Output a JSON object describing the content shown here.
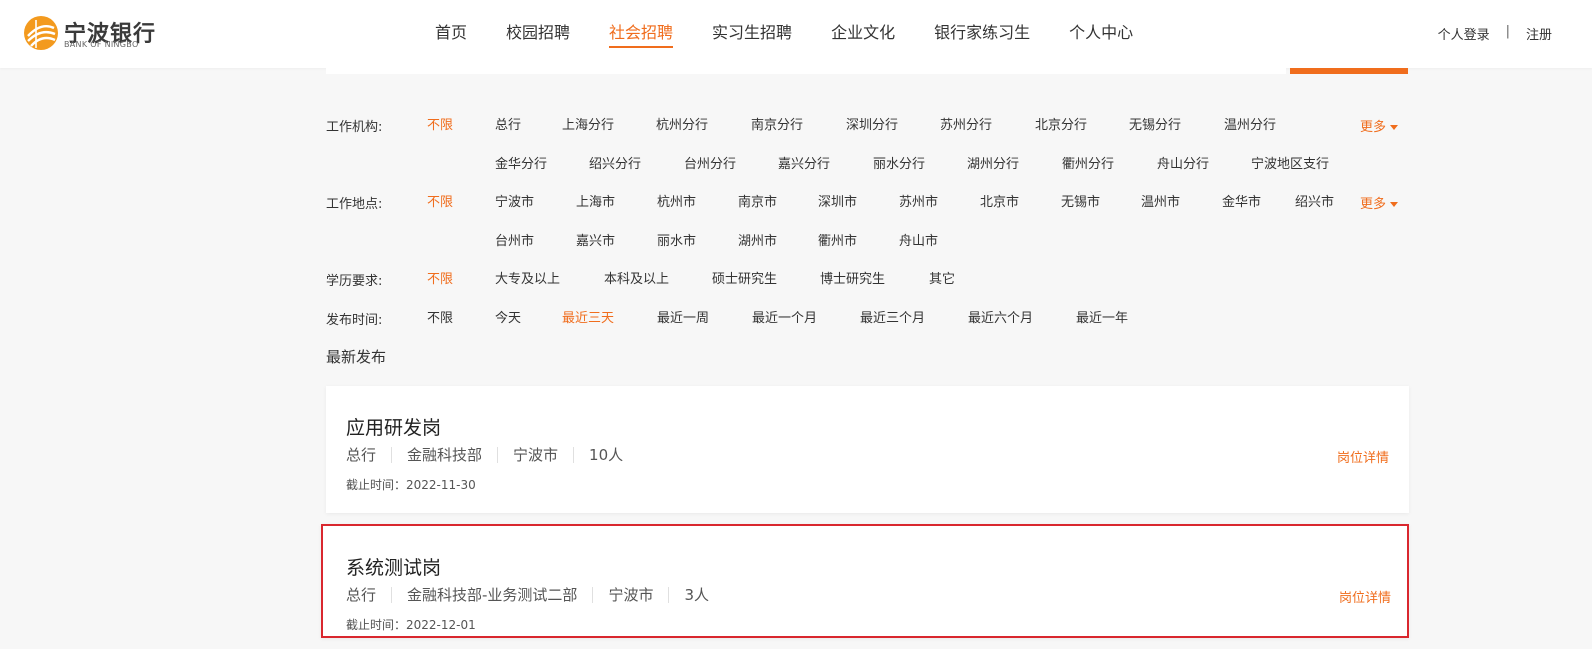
{
  "header": {
    "logo_cn": "宁波银行",
    "logo_en": "BANK OF NINGBO",
    "nav": [
      {
        "label": "首页",
        "active": false
      },
      {
        "label": "校园招聘",
        "active": false
      },
      {
        "label": "社会招聘",
        "active": true
      },
      {
        "label": "实习生招聘",
        "active": false
      },
      {
        "label": "企业文化",
        "active": false
      },
      {
        "label": "银行家练习生",
        "active": false
      },
      {
        "label": "个人中心",
        "active": false
      }
    ],
    "login": "个人登录",
    "separator": "|",
    "register": "注册"
  },
  "filters": {
    "org": {
      "label": "工作机构:",
      "unlimited": "不限",
      "row1": [
        "总行",
        "上海分行",
        "杭州分行",
        "南京分行",
        "深圳分行",
        "苏州分行",
        "北京分行",
        "无锡分行",
        "温州分行"
      ],
      "row2": [
        "金华分行",
        "绍兴分行",
        "台州分行",
        "嘉兴分行",
        "丽水分行",
        "湖州分行",
        "衢州分行",
        "舟山分行",
        "宁波地区支行"
      ],
      "more": "更多"
    },
    "location": {
      "label": "工作地点:",
      "unlimited": "不限",
      "row1": [
        "宁波市",
        "上海市",
        "杭州市",
        "南京市",
        "深圳市",
        "苏州市",
        "北京市",
        "无锡市",
        "温州市",
        "金华市",
        "绍兴市"
      ],
      "row2": [
        "台州市",
        "嘉兴市",
        "丽水市",
        "湖州市",
        "衢州市",
        "舟山市"
      ],
      "more": "更多"
    },
    "education": {
      "label": "学历要求:",
      "unlimited": "不限",
      "options": [
        "大专及以上",
        "本科及以上",
        "硕士研究生",
        "博士研究生",
        "其它"
      ]
    },
    "time": {
      "label": "发布时间:",
      "unlimited": "不限",
      "options": [
        "今天",
        "最近三天",
        "最近一周",
        "最近一个月",
        "最近三个月",
        "最近六个月",
        "最近一年"
      ],
      "active": "最近三天"
    }
  },
  "latest_label": "最新发布",
  "jobs": [
    {
      "title": "应用研发岗",
      "meta": [
        "总行",
        "金融科技部",
        "宁波市",
        "10人"
      ],
      "deadline": "截止时间：2022-11-30",
      "detail": "岗位详情"
    },
    {
      "title": "系统测试岗",
      "meta": [
        "总行",
        "金融科技部-业务测试二部",
        "宁波市",
        "3人"
      ],
      "deadline": "截止时间：2022-12-01",
      "detail": "岗位详情"
    }
  ],
  "colors": {
    "accent": "#f06d1d",
    "highlight_border": "#d9272e"
  }
}
